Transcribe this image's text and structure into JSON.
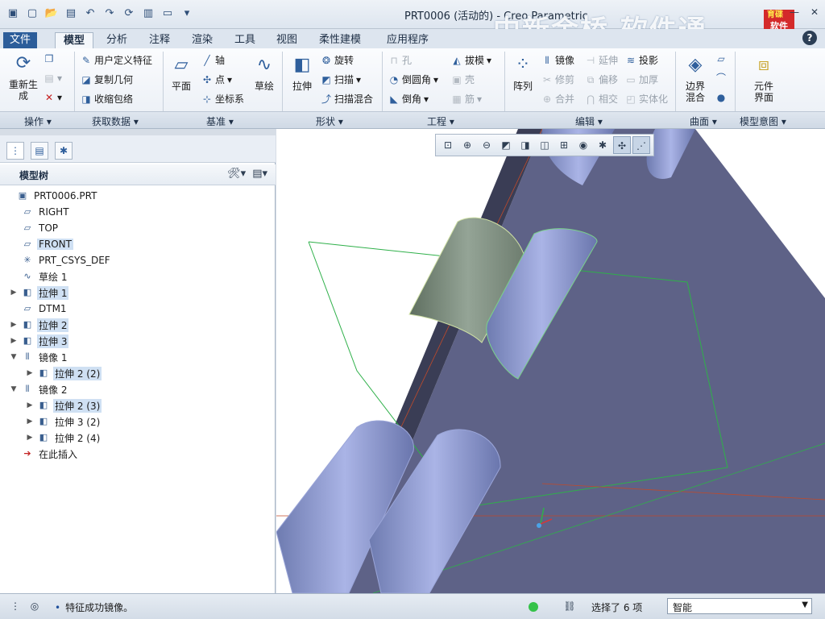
{
  "window": {
    "title": "PRT0006 (活动的) - Creo Parametric",
    "watermark": "中新金桥  软件通",
    "logo_top": "育碟",
    "logo_bottom": "软件"
  },
  "menu_tabs": [
    "文件",
    "模型",
    "分析",
    "注释",
    "渲染",
    "工具",
    "视图",
    "柔性建模",
    "应用程序"
  ],
  "ribbon": {
    "operations": {
      "regenerate": "重新生成"
    },
    "get_data": {
      "user_feature": "用户定义特征",
      "copy_geometry": "复制几何",
      "shrinkwrap": "收缩包络"
    },
    "datum": {
      "plane": "平面",
      "axis": "轴",
      "point": "点",
      "csys": "坐标系",
      "sketch": "草绘"
    },
    "shapes": {
      "extrude": "拉伸",
      "revolve": "旋转",
      "sweep": "扫描",
      "swept_blend": "扫描混合"
    },
    "engineering": {
      "hole": "孔",
      "round": "倒圆角",
      "chamfer": "倒角",
      "draft": "拔模",
      "shell": "壳",
      "rib": "筋"
    },
    "editing": {
      "pattern": "阵列",
      "mirror": "镜像",
      "trim": "修剪",
      "merge": "合并",
      "extend": "延伸",
      "offset": "偏移",
      "intersect": "相交",
      "project": "投影",
      "thicken": "加厚",
      "solidify": "实体化"
    },
    "surfaces": {
      "boundary_blend": "边界混合"
    },
    "model_intent": {
      "component_interface": "元件界面"
    },
    "groups": [
      "操作",
      "获取数据",
      "基准",
      "形状",
      "工程",
      "编辑",
      "曲面",
      "模型意图"
    ]
  },
  "model_tree": {
    "title": "模型树",
    "items": [
      {
        "label": "PRT0006.PRT",
        "icon": "part-icon",
        "indent": 0,
        "arrow": "",
        "hl": false
      },
      {
        "label": "RIGHT",
        "icon": "datum-plane-icon",
        "indent": 1,
        "arrow": "",
        "hl": false
      },
      {
        "label": "TOP",
        "icon": "datum-plane-icon",
        "indent": 1,
        "arrow": "",
        "hl": false
      },
      {
        "label": "FRONT",
        "icon": "datum-plane-icon",
        "indent": 1,
        "arrow": "",
        "hl": true
      },
      {
        "label": "PRT_CSYS_DEF",
        "icon": "csys-icon",
        "indent": 1,
        "arrow": "",
        "hl": false
      },
      {
        "label": "草绘 1",
        "icon": "sketch-icon",
        "indent": 1,
        "arrow": "",
        "hl": false
      },
      {
        "label": "拉伸 1",
        "icon": "extrude-icon",
        "indent": 1,
        "arrow": "▶",
        "hl": true
      },
      {
        "label": "DTM1",
        "icon": "datum-plane-icon",
        "indent": 1,
        "arrow": "",
        "hl": false
      },
      {
        "label": "拉伸 2",
        "icon": "extrude-icon",
        "indent": 1,
        "arrow": "▶",
        "hl": true
      },
      {
        "label": "拉伸 3",
        "icon": "extrude-icon",
        "indent": 1,
        "arrow": "▶",
        "hl": true
      },
      {
        "label": "镜像 1",
        "icon": "mirror-icon",
        "indent": 1,
        "arrow": "▼",
        "hl": false
      },
      {
        "label": "拉伸 2 (2)",
        "icon": "extrude-icon",
        "indent": 2,
        "arrow": "▶",
        "hl": true
      },
      {
        "label": "镜像 2",
        "icon": "mirror-icon",
        "indent": 1,
        "arrow": "▼",
        "hl": false
      },
      {
        "label": "拉伸 2 (3)",
        "icon": "extrude-icon",
        "indent": 2,
        "arrow": "▶",
        "hl": true
      },
      {
        "label": "拉伸 3 (2)",
        "icon": "extrude-icon",
        "indent": 2,
        "arrow": "▶",
        "hl": false
      },
      {
        "label": "拉伸 2 (4)",
        "icon": "extrude-icon",
        "indent": 2,
        "arrow": "▶",
        "hl": false
      },
      {
        "label": "在此插入",
        "icon": "insert-here-icon",
        "indent": 1,
        "arrow": "",
        "hl": false
      }
    ]
  },
  "status": {
    "message": "特征成功镜像。",
    "selection": "选择了 6 项",
    "filter": "智能"
  }
}
